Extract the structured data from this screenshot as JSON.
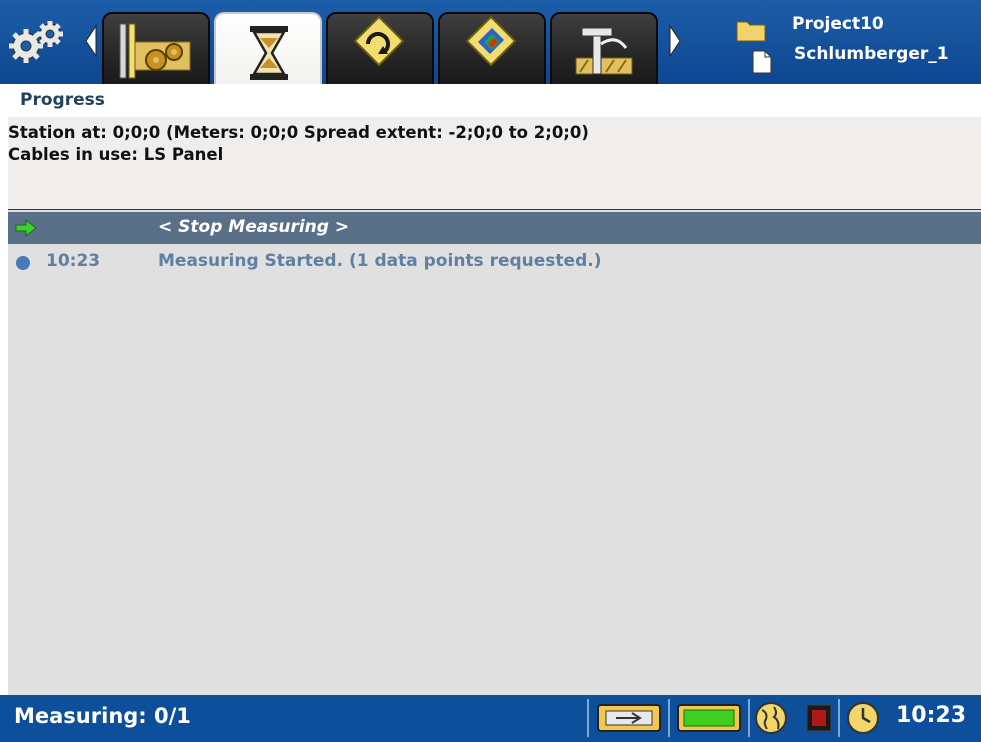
{
  "header": {
    "project_name": "Project10",
    "station_name": "Schlumberger_1",
    "tabs": [
      {
        "name": "configuration",
        "active": false
      },
      {
        "name": "progress",
        "active": true
      },
      {
        "name": "rollalong",
        "active": false
      },
      {
        "name": "results",
        "active": false
      },
      {
        "name": "survey",
        "active": false
      }
    ]
  },
  "page": {
    "title": "Progress"
  },
  "info": {
    "station_line": "Station at: 0;0;0 (Meters: 0;0;0 Spread extent: -2;0;0 to 2;0;0)",
    "cables_line": "Cables in use: LS Panel"
  },
  "list": {
    "stop_label": "< Stop Measuring >",
    "entries": [
      {
        "time": "10:23",
        "message": "Measuring Started. (1 data points requested.)"
      }
    ]
  },
  "statusbar": {
    "status_text": "Measuring: 0/1",
    "clock": "10:23",
    "icons": [
      "power-connector-icon",
      "battery-icon",
      "globe-icon",
      "record-indicator-icon",
      "clock-icon"
    ]
  },
  "colors": {
    "topbar_blue": "#1c5ea8",
    "statusbar_blue": "#0d4f9b",
    "selected_row": "#5a7088",
    "log_text": "#5f7fa3",
    "title_text": "#23415f"
  }
}
